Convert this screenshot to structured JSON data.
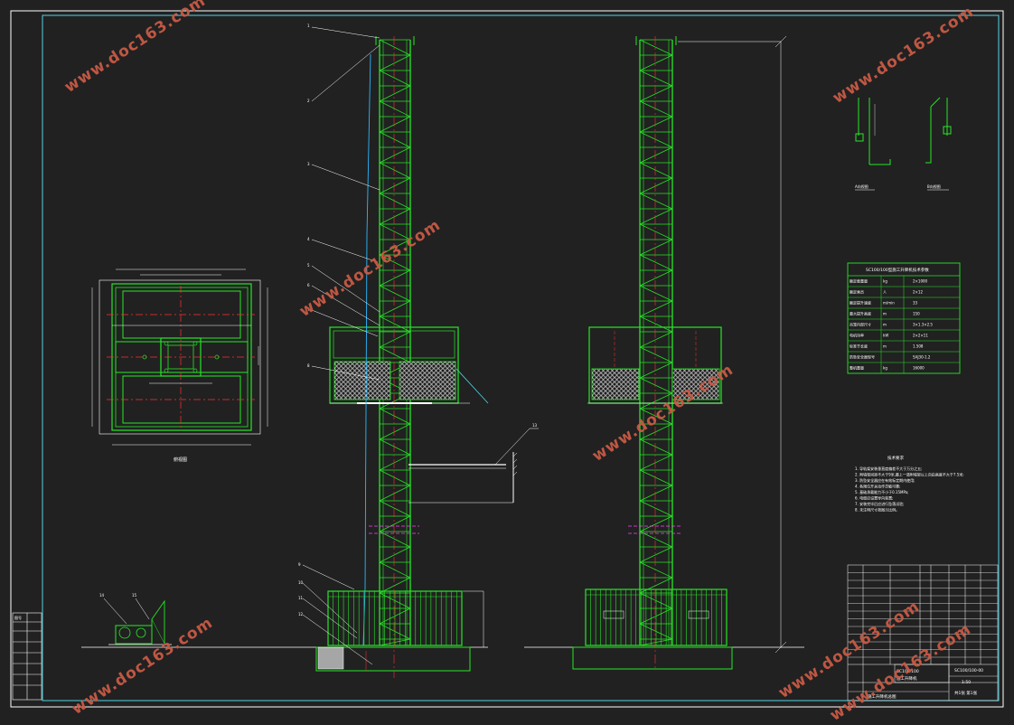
{
  "drawing": {
    "sheet_name": "施工升降机总图",
    "colors": {
      "background": "#212121",
      "frame": "#ffffff",
      "inner_frame": "#4fd3e6",
      "mast": "#26e626",
      "cage_mesh": "#ffffff",
      "center_line": "#ff3030",
      "cable": "#2ab8ff",
      "dimension": "#ffffff",
      "magenta_mark": "#ff40ff",
      "watermark": "#c85a45"
    },
    "watermarks": [
      "www.doc163.com",
      "www.doc163.com",
      "www.doc163.com",
      "www.doc163.com",
      "www.doc163.com",
      "www.doc163.com",
      "www.doc163.com"
    ],
    "views": {
      "plan_view_label": "俯视图",
      "detail_a_label": "A向视图",
      "detail_b_label": "B向视图"
    },
    "callouts": [
      "1",
      "2",
      "3",
      "4",
      "5",
      "6",
      "7",
      "8",
      "9",
      "10",
      "11",
      "12",
      "13",
      "14",
      "15"
    ],
    "spec_table": {
      "title": "SC100/100型施工升降机技术参数",
      "rows": [
        [
          "额定载重量",
          "kg",
          "2×1000"
        ],
        [
          "额定乘员",
          "人",
          "2×12"
        ],
        [
          "额定提升速度",
          "m/min",
          "33"
        ],
        [
          "最大提升高度",
          "m",
          "150"
        ],
        [
          "吊笼内部尺寸",
          "m",
          "3×1.3×2.5"
        ],
        [
          "电机功率",
          "kW",
          "2×2×11"
        ],
        [
          "标准节长度",
          "m",
          "1.508"
        ],
        [
          "防坠安全器型号",
          "",
          "SAJ30-1.2"
        ],
        [
          "整机重量",
          "kg",
          "16000"
        ]
      ]
    },
    "notes": {
      "title": "技术要求",
      "lines": [
        "1. 导轨架安装垂直度偏差不大于万分之五;",
        "2. 附墙架间距不大于9米,最上一道附墙架以上自由高度不大于7.5米;",
        "3. 防坠安全器应在有效标定期内使用;",
        "4. 各限位开关动作灵敏可靠;",
        "5. 基础承载能力不小于0.15MPa;",
        "6. 电缆应设置导向装置;",
        "7. 安装完毕后应进行坠落试验;",
        "8. 未注明尺寸按图示比例。"
      ]
    },
    "title_block": {
      "drawing_title": "SC100/100",
      "drawing_subtitle": "施工升降机",
      "drawing_number": "SC100/100-00",
      "scale": "1:50",
      "sheet": "共1张 第1张"
    },
    "left_table_label": "图号"
  }
}
